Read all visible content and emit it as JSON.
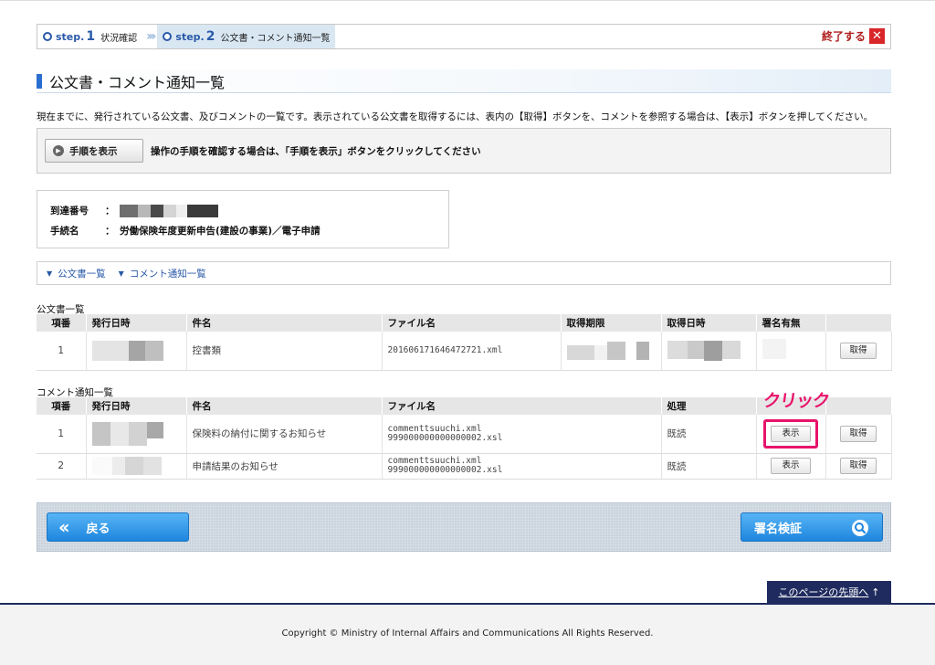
{
  "steps": [
    {
      "label": "step.",
      "number": "1",
      "name": "状況確認"
    },
    {
      "label": "step.",
      "number": "2",
      "name": "公文書・コメント通知一覧"
    }
  ],
  "quit_label": "終了する",
  "page_title": "公文書・コメント通知一覧",
  "description": "現在までに、発行されている公文書、及びコメントの一覧です。表示されている公文書を取得するには、表内の【取得】ボタンを、コメントを参照する場合は、【表示】ボタンを押してください。",
  "procedure": {
    "button_label": "手順を表示",
    "text": "操作の手順を確認する場合は、「手順を表示」ボタンをクリックしてください"
  },
  "info": {
    "arrival_label": "到達番号",
    "procedure_label": "手続名",
    "colon": "：",
    "procedure_name": "労働保険年度更新申告(建設の事業)／電子申請"
  },
  "anchors": [
    "公文書一覧",
    "コメント通知一覧"
  ],
  "documents": {
    "caption": "公文書一覧",
    "headers": [
      "項番",
      "発行日時",
      "件名",
      "ファイル名",
      "取得期限",
      "取得日時",
      "署名有無",
      ""
    ],
    "rows": [
      {
        "no": "1",
        "subject": "控書類",
        "file": "201606171646472721.xml",
        "action": "取得"
      }
    ]
  },
  "comments": {
    "caption": "コメント通知一覧",
    "headers": [
      "項番",
      "発行日時",
      "件名",
      "ファイル名",
      "処理",
      "",
      ""
    ],
    "rows": [
      {
        "no": "1",
        "subject": "保険料の納付に関するお知らせ",
        "file1": "commenttsuuchi.xml",
        "file2": "999000000000000002.xsl",
        "status": "既読",
        "view": "表示",
        "get": "取得"
      },
      {
        "no": "2",
        "subject": "申請結果のお知らせ",
        "file1": "commenttsuuchi.xml",
        "file2": "999000000000000002.xsl",
        "status": "既読",
        "view": "表示",
        "get": "取得"
      }
    ]
  },
  "callout": "クリック",
  "buttons": {
    "back": "戻る",
    "verify": "署名検証"
  },
  "top_link": "このページの先頭へ",
  "copyright": "Copyright © Ministry of Internal Affairs and Communications All Rights Reserved.",
  "colors": {
    "accent": "#2a5aa8",
    "highlight": "#e8136b",
    "button_blue": "#1e86de",
    "footer_navy": "#1f2b5e",
    "quit_red": "#d8262a"
  }
}
